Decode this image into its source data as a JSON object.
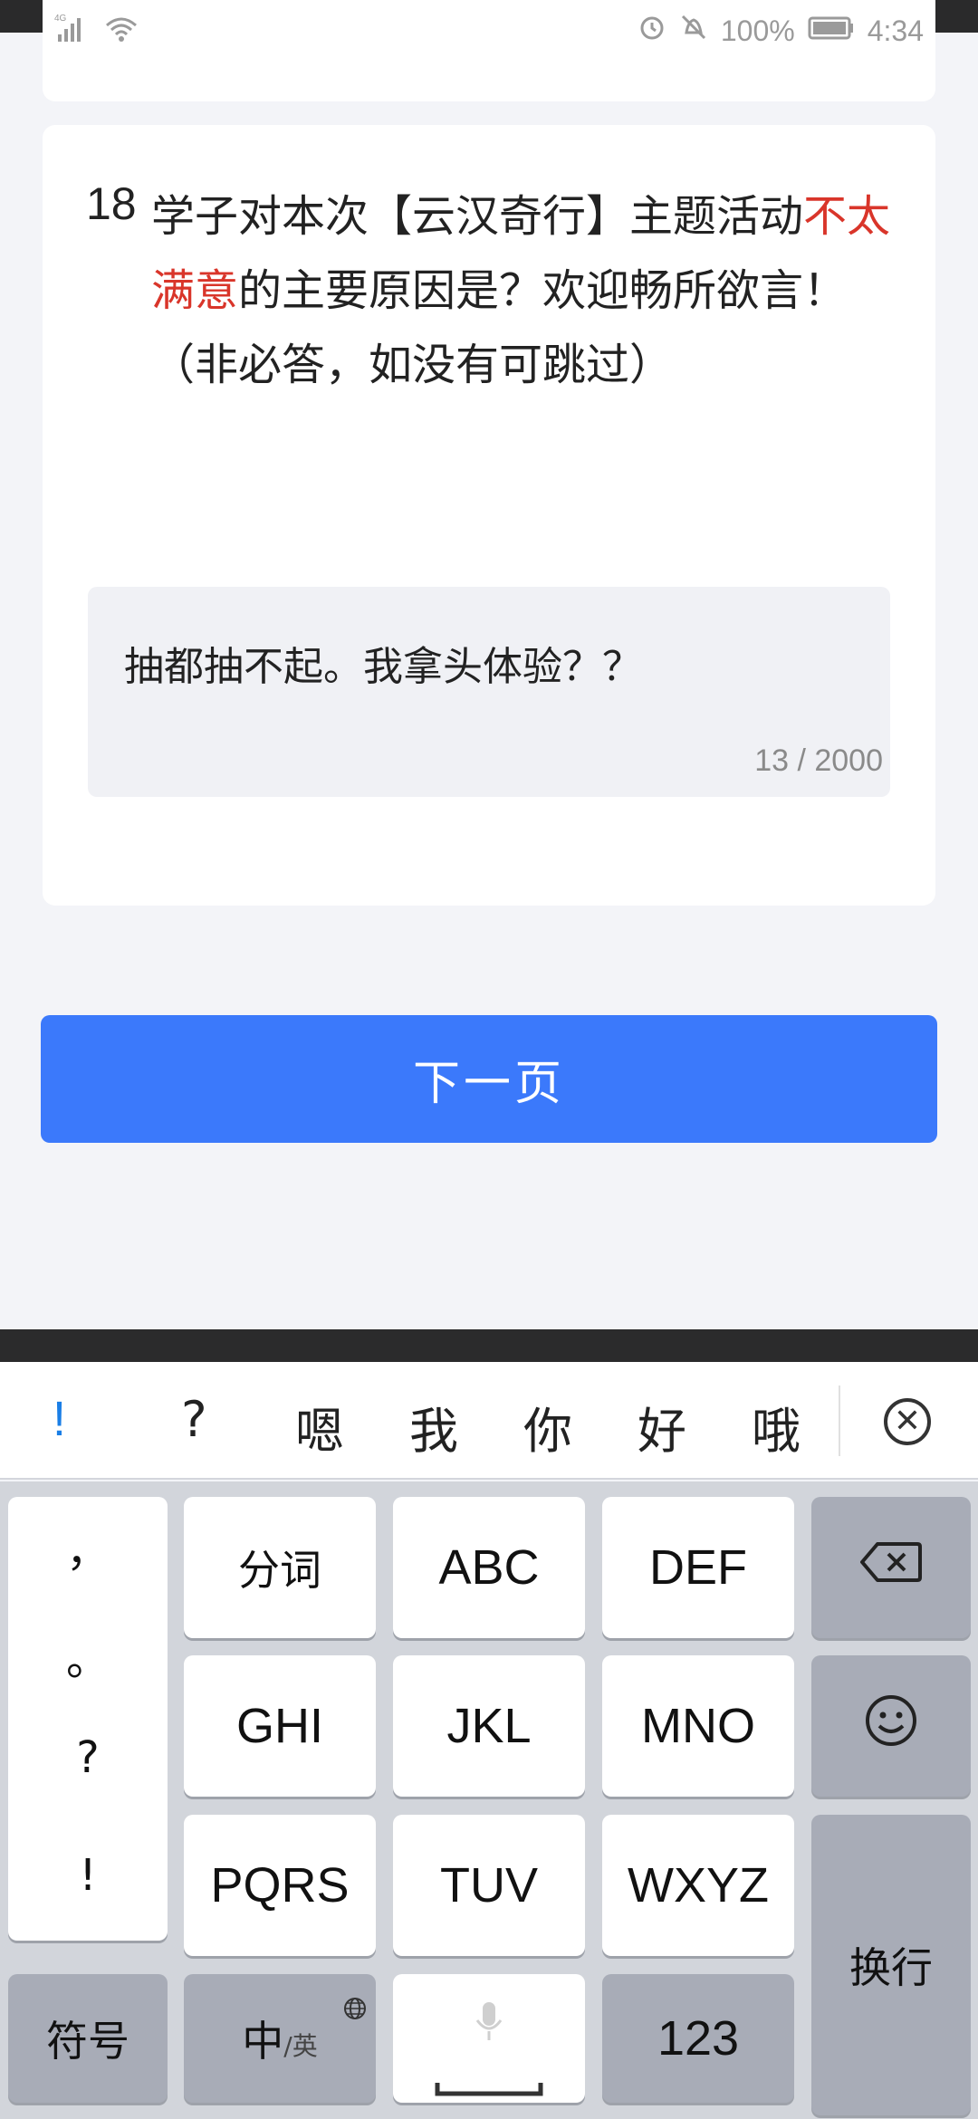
{
  "status": {
    "network": "4G",
    "battery": "100%",
    "time": "4:34"
  },
  "question": {
    "number": "18",
    "text_before": "学子对本次【云汉奇行】主题活动",
    "text_highlight": "不太满意",
    "text_after": "的主要原因是？欢迎畅所欲言！（非必答，如没有可跳过）",
    "answer_text": "抽都抽不起。我拿头体验？？",
    "char_count": "13 / 2000"
  },
  "next_button": {
    "label": "下一页"
  },
  "keyboard": {
    "candidates": [
      "!",
      "?",
      "嗯",
      "我",
      "你",
      "好",
      "哦"
    ],
    "punctuation": [
      "，",
      "。",
      "?",
      "!"
    ],
    "row1": [
      "分词",
      "ABC",
      "DEF"
    ],
    "row2": [
      "GHI",
      "JKL",
      "MNO"
    ],
    "row3": [
      "PQRS",
      "TUV",
      "WXYZ"
    ],
    "symbols_label": "符号",
    "lang_main": "中",
    "lang_sub": "/英",
    "numbers_label": "123",
    "enter_label": "换行"
  },
  "colors": {
    "accent": "#3b79fb",
    "highlight": "#d9352a",
    "candidate_active": "#1a7ee6"
  }
}
